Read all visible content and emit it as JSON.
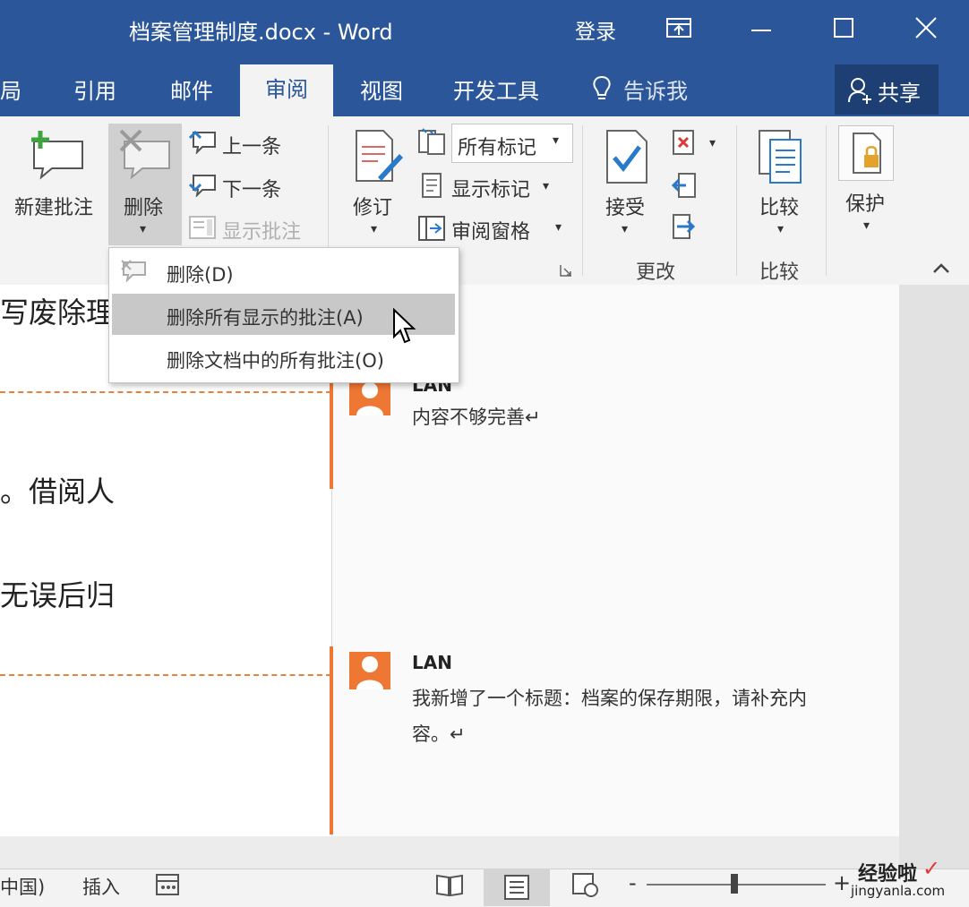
{
  "window": {
    "title": "档案管理制度.docx - Word",
    "login": "登录"
  },
  "tabs": [
    "局",
    "引用",
    "邮件",
    "审阅",
    "视图",
    "开发工具",
    "告诉我"
  ],
  "share_label": "共享",
  "ribbon": {
    "new_comment": "新建批注",
    "delete": "删除",
    "previous": "上一条",
    "next": "下一条",
    "show_comments": "显示批注",
    "track_changes": "修订",
    "markup_select": "所有标记",
    "show_markup": "显示标记",
    "reviewing_pane": "审阅窗格",
    "accept": "接受",
    "group_changes": "更改",
    "compare": "比较",
    "group_compare": "比较",
    "protect": "保护"
  },
  "delete_menu": {
    "items": [
      "删除(D)",
      "删除所有显示的批注(A)",
      "删除文档中的所有批注(O)"
    ]
  },
  "document": {
    "lines": [
      "写废除理",
      "。借阅人",
      "无误后归"
    ]
  },
  "comments": [
    {
      "author": "LAN",
      "text": "内容不够完善↵"
    },
    {
      "author": "LAN",
      "text_line1": "我新增了一个标题：档案的保存期限，请补充内",
      "text_line2": "容。↵"
    }
  ],
  "statusbar": {
    "language": "中国)",
    "insert_mode": "插入",
    "zoom_minus": "-",
    "zoom_plus": "+"
  },
  "watermark": {
    "brand": "经验啦",
    "url": "jingyanla.com"
  },
  "colors": {
    "accent": "#2b579a",
    "comment_mark": "#ee7734"
  }
}
